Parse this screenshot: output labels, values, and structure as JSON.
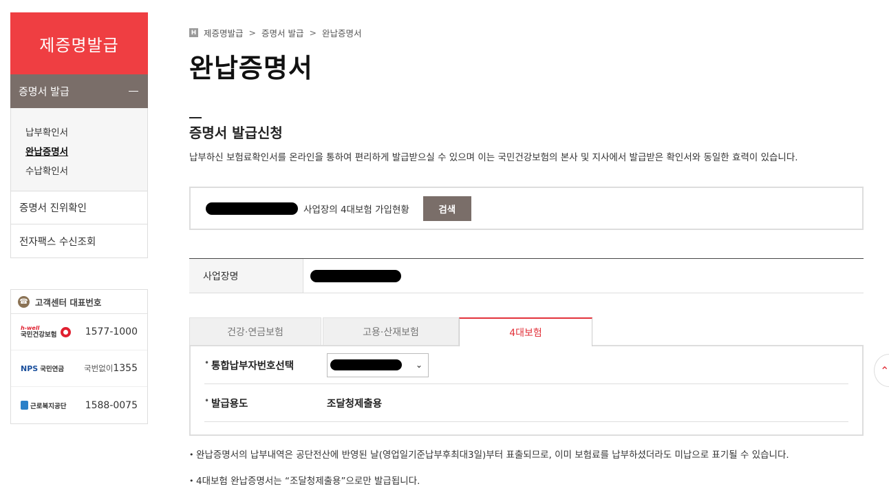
{
  "sidebar": {
    "title": "제증명발급",
    "section": "증명서 발급",
    "sub_items": [
      {
        "label": "납부확인서",
        "active": false
      },
      {
        "label": "완납증명서",
        "active": true
      },
      {
        "label": "수납확인서",
        "active": false
      }
    ],
    "links": [
      "증명서 진위확인",
      "전자팩스 수신조회"
    ]
  },
  "contact": {
    "title": "고객센터 대표번호",
    "rows": [
      {
        "org": "국민건강보험",
        "brand": "h-well",
        "number": "1577-1000"
      },
      {
        "org": "국민연금",
        "brand": "NPS",
        "prefix": "국번없이",
        "number": "1355"
      },
      {
        "org": "근로복지공단",
        "number": "1588-0075"
      }
    ]
  },
  "breadcrumb": {
    "home_glyph": "H",
    "items": [
      "제증명발급",
      "증명서 발급",
      "완납증명서"
    ],
    "separator": ">"
  },
  "page_title": "완납증명서",
  "section_title": "증명서 발급신청",
  "description": "납부하신 보험료확인서를 온라인을 통하여 편리하게 발급받으실 수 있으며 이는 국민건강보험의 본사 및 지사에서 발급받은 확인서와 동일한 효력이 있습니다.",
  "search": {
    "label": "사업장의 4대보험 가입현황",
    "button": "검색"
  },
  "business": {
    "header": "사업장명"
  },
  "tabs": [
    {
      "label": "건강·연금보험",
      "active": false
    },
    {
      "label": "고용·산재보험",
      "active": false
    },
    {
      "label": "4대보험",
      "active": true
    }
  ],
  "form": {
    "payer_label": "통합납부자번호선택",
    "purpose_label": "발급용도",
    "purpose_value": "조달청제출용"
  },
  "notes": [
    "완납증명서의 납부내역은 공단전산에 반영된 날(영업일기준납부후최대3일)부터 표출되므로, 이미 보험료를 납부하셨더라도 미납으로 표기될 수 있습니다.",
    "4대보험 완납증명서는 “조달청제출용”으로만 발급됩니다."
  ],
  "colors": {
    "brand_red": "#ef3e42",
    "brown": "#7a6e69",
    "active_tab": "#e2313a"
  }
}
